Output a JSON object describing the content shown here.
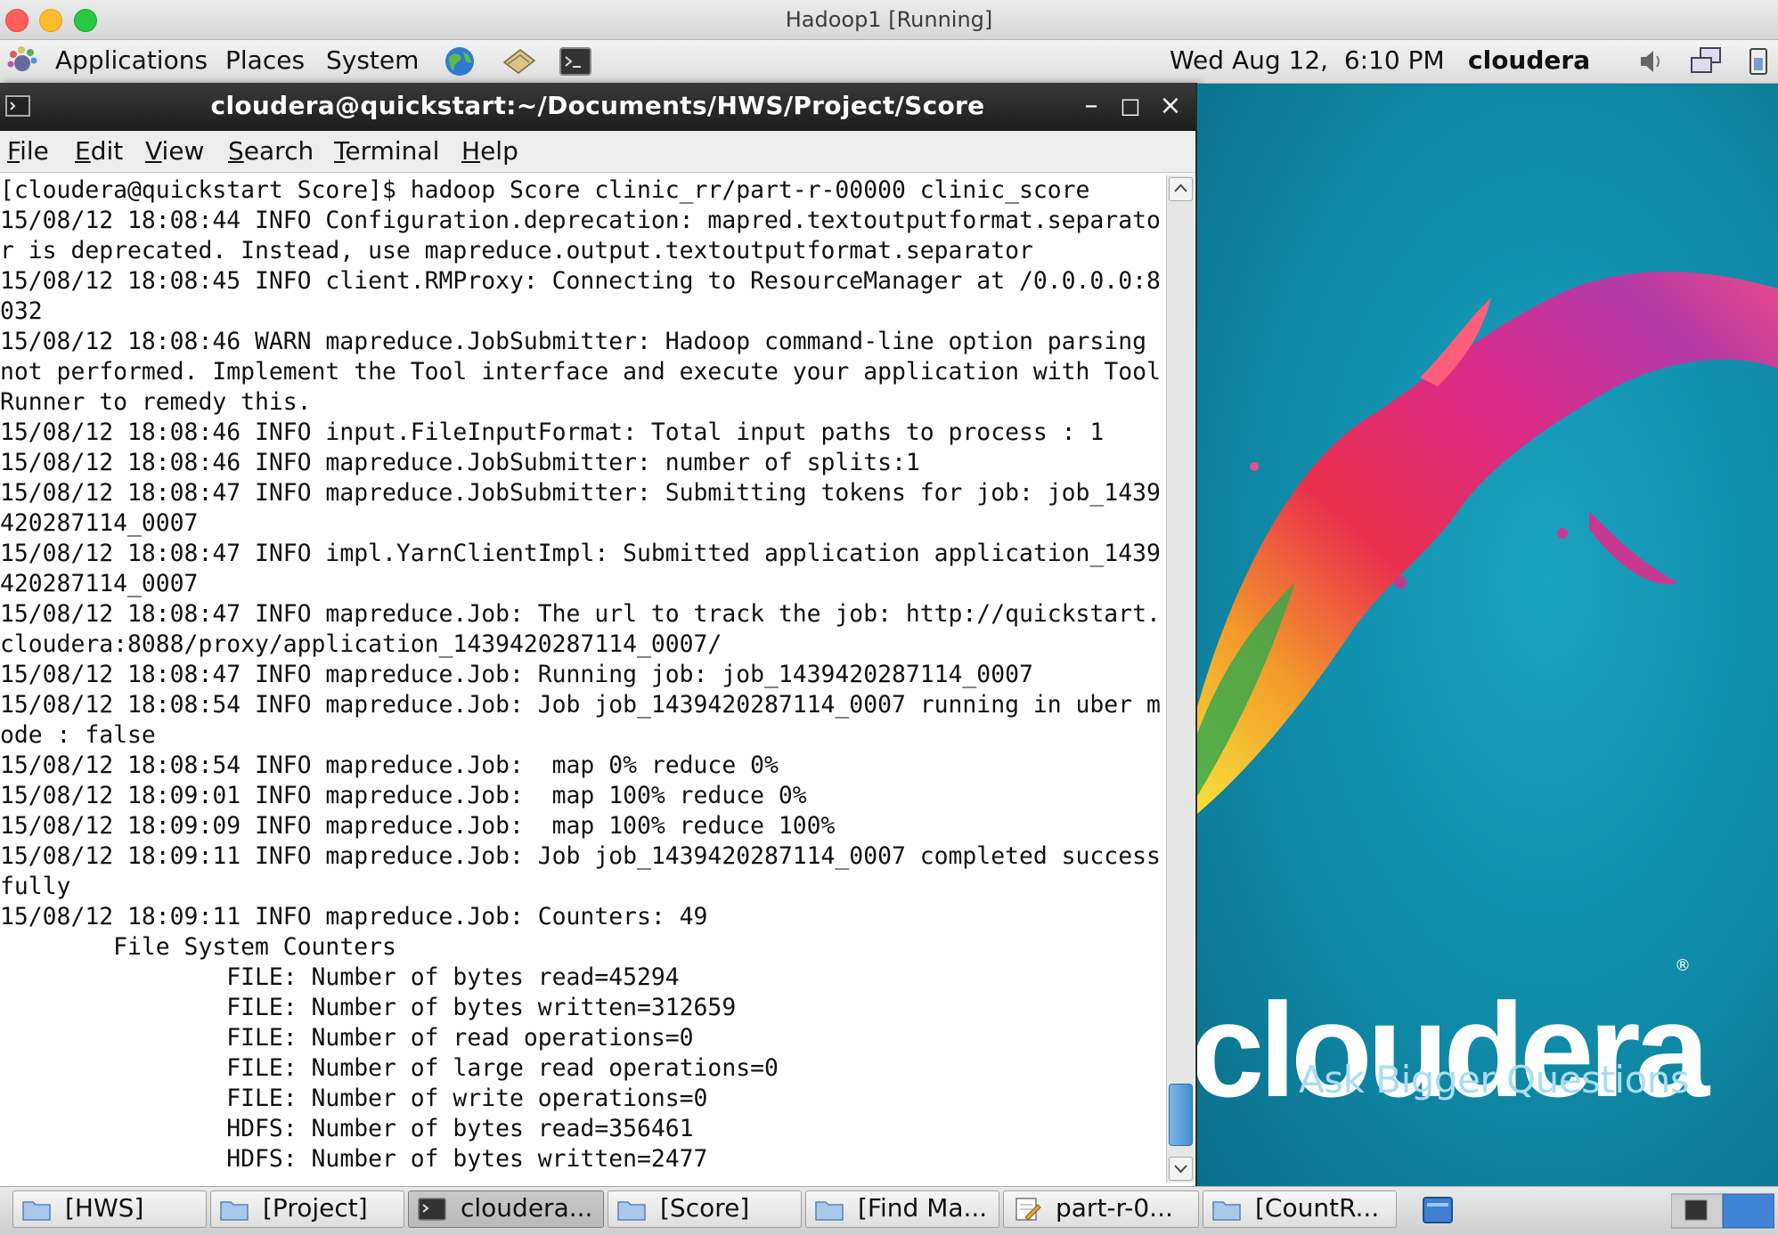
{
  "host_window": {
    "title": "Hadoop1 [Running]"
  },
  "panel": {
    "applications": "Applications",
    "places": "Places",
    "system": "System",
    "launchers": [
      "web-browser-icon",
      "notes-icon",
      "terminal-icon"
    ],
    "clock": "Wed Aug 12,  6:10 PM",
    "user": "cloudera",
    "tray": [
      "volume-icon",
      "network-icon",
      "power-icon"
    ]
  },
  "terminal": {
    "title": "cloudera@quickstart:~/Documents/HWS/Project/Score",
    "menu": [
      {
        "label": "File",
        "mnemonic": "F"
      },
      {
        "label": "Edit",
        "mnemonic": "E"
      },
      {
        "label": "View",
        "mnemonic": "V"
      },
      {
        "label": "Search",
        "mnemonic": "S"
      },
      {
        "label": "Terminal",
        "mnemonic": "T"
      },
      {
        "label": "Help",
        "mnemonic": "H"
      }
    ],
    "lines": [
      "[cloudera@quickstart Score]$ hadoop Score clinic_rr/part-r-00000 clinic_score",
      "15/08/12 18:08:44 INFO Configuration.deprecation: mapred.textoutputformat.separato",
      "r is deprecated. Instead, use mapreduce.output.textoutputformat.separator",
      "15/08/12 18:08:45 INFO client.RMProxy: Connecting to ResourceManager at /0.0.0.0:8",
      "032",
      "15/08/12 18:08:46 WARN mapreduce.JobSubmitter: Hadoop command-line option parsing",
      "not performed. Implement the Tool interface and execute your application with Tool",
      "Runner to remedy this.",
      "15/08/12 18:08:46 INFO input.FileInputFormat: Total input paths to process : 1",
      "15/08/12 18:08:46 INFO mapreduce.JobSubmitter: number of splits:1",
      "15/08/12 18:08:47 INFO mapreduce.JobSubmitter: Submitting tokens for job: job_1439",
      "420287114_0007",
      "15/08/12 18:08:47 INFO impl.YarnClientImpl: Submitted application application_1439",
      "420287114_0007",
      "15/08/12 18:08:47 INFO mapreduce.Job: The url to track the job: http://quickstart.",
      "cloudera:8088/proxy/application_1439420287114_0007/",
      "15/08/12 18:08:47 INFO mapreduce.Job: Running job: job_1439420287114_0007",
      "15/08/12 18:08:54 INFO mapreduce.Job: Job job_1439420287114_0007 running in uber m",
      "ode : false",
      "15/08/12 18:08:54 INFO mapreduce.Job:  map 0% reduce 0%",
      "15/08/12 18:09:01 INFO mapreduce.Job:  map 100% reduce 0%",
      "15/08/12 18:09:09 INFO mapreduce.Job:  map 100% reduce 100%",
      "15/08/12 18:09:11 INFO mapreduce.Job: Job job_1439420287114_0007 completed success",
      "fully",
      "15/08/12 18:09:11 INFO mapreduce.Job: Counters: 49",
      "\tFile System Counters",
      "\t\tFILE: Number of bytes read=45294",
      "\t\tFILE: Number of bytes written=312659",
      "\t\tFILE: Number of read operations=0",
      "\t\tFILE: Number of large read operations=0",
      "\t\tFILE: Number of write operations=0",
      "\t\tHDFS: Number of bytes read=356461",
      "\t\tHDFS: Number of bytes written=2477"
    ]
  },
  "desktop": {
    "brand": "cloudera",
    "registered": "®",
    "tagline": "Ask Bigger Questions"
  },
  "taskbar": [
    {
      "label": "[HWS]",
      "icon": "folder-icon",
      "active": false
    },
    {
      "label": "[Project]",
      "icon": "folder-icon",
      "active": false
    },
    {
      "label": "cloudera...",
      "icon": "terminal-icon",
      "active": true
    },
    {
      "label": "[Score]",
      "icon": "folder-icon",
      "active": false
    },
    {
      "label": "[Find Ma...",
      "icon": "folder-icon",
      "active": false
    },
    {
      "label": "part-r-0...",
      "icon": "text-editor-icon",
      "active": false
    },
    {
      "label": "[CountR...",
      "icon": "folder-icon",
      "active": false
    }
  ],
  "colors": {
    "terminal_titlebar": "#2a2a2a",
    "desktop_bg": "#0f8aa8",
    "tagline": "#a9ddef",
    "scroll_thumb": "#3f8fd4"
  }
}
